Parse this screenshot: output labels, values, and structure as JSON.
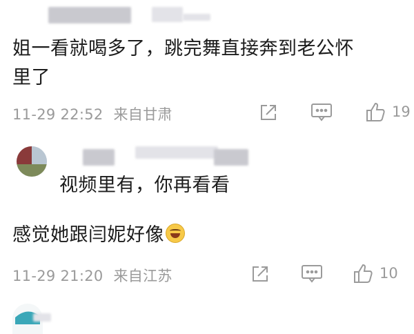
{
  "comment1": {
    "text_line1": "姐一看就喝多了，跳完舞直接奔到老公怀",
    "text_line2": "里了",
    "time": "11-29 22:52",
    "location": "来自甘肃",
    "likes": "19"
  },
  "reply": {
    "text": "视频里有，你再看看"
  },
  "comment2": {
    "text": "感觉她跟闫妮好像",
    "emoji": "laughing-tears-emoji",
    "time": "11-29 21:20",
    "location": "来自江苏",
    "likes": "10"
  },
  "icons": {
    "share": "share-icon",
    "comment": "comment-icon",
    "like": "like-icon"
  },
  "colors": {
    "meta_gray": "#9a9a9a",
    "text": "#1c1c1c"
  }
}
